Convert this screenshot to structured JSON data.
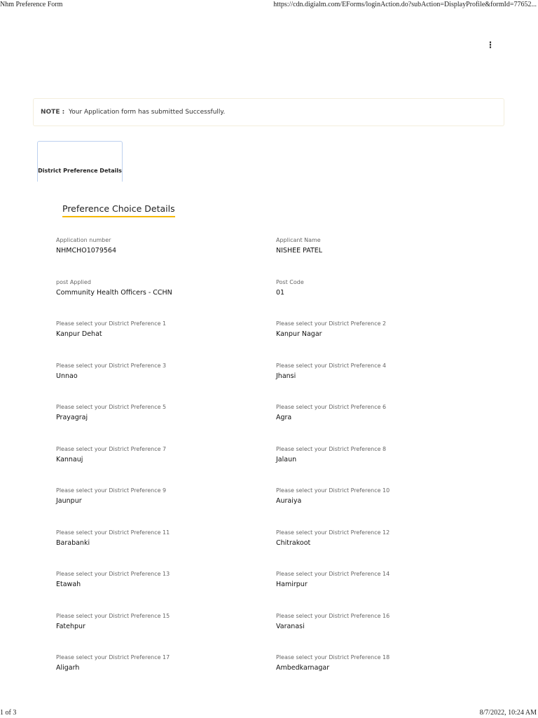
{
  "header": {
    "title": "Nhm Preference Form",
    "url": "https://cdn.digialm.com/EForms/loginAction.do?subAction=DisplayProfile&formId=77652..."
  },
  "note": {
    "label": "NOTE :",
    "text": "Your Application form has submitted Successfully."
  },
  "tab": {
    "label": "District Preference Details"
  },
  "section_title": "Preference Choice Details",
  "fields": [
    {
      "label": "Application number",
      "value": "NHMCHO1079564"
    },
    {
      "label": "Applicant Name",
      "value": "NISHEE PATEL"
    },
    {
      "label": "post Applied",
      "value": "Community Health Officers - CCHN"
    },
    {
      "label": "Post Code",
      "value": "01"
    },
    {
      "label": "Please select your District Preference 1",
      "value": "Kanpur Dehat"
    },
    {
      "label": "Please select your District Preference 2",
      "value": "Kanpur Nagar"
    },
    {
      "label": "Please select your District Preference 3",
      "value": "Unnao"
    },
    {
      "label": "Please select your District Preference 4",
      "value": "Jhansi"
    },
    {
      "label": "Please select your District Preference 5",
      "value": "Prayagraj"
    },
    {
      "label": "Please select your District Preference 6",
      "value": "Agra"
    },
    {
      "label": "Please select your District Preference 7",
      "value": "Kannauj"
    },
    {
      "label": "Please select your District Preference 8",
      "value": "Jalaun"
    },
    {
      "label": "Please select your District Preference 9",
      "value": "Jaunpur"
    },
    {
      "label": "Please select your District Preference 10",
      "value": "Auraiya"
    },
    {
      "label": "Please select your District Preference 11",
      "value": "Barabanki"
    },
    {
      "label": "Please select your District Preference 12",
      "value": "Chitrakoot"
    },
    {
      "label": "Please select your District Preference 13",
      "value": "Etawah"
    },
    {
      "label": "Please select your District Preference 14",
      "value": "Hamirpur"
    },
    {
      "label": "Please select your District Preference 15",
      "value": "Fatehpur"
    },
    {
      "label": "Please select your District Preference 16",
      "value": "Varanasi"
    },
    {
      "label": "Please select your District Preference 17",
      "value": "Aligarh"
    },
    {
      "label": "Please select your District Preference 18",
      "value": "Ambedkarnagar"
    }
  ],
  "footer": {
    "page": "1 of 3",
    "datetime": "8/7/2022, 10:24 AM"
  }
}
